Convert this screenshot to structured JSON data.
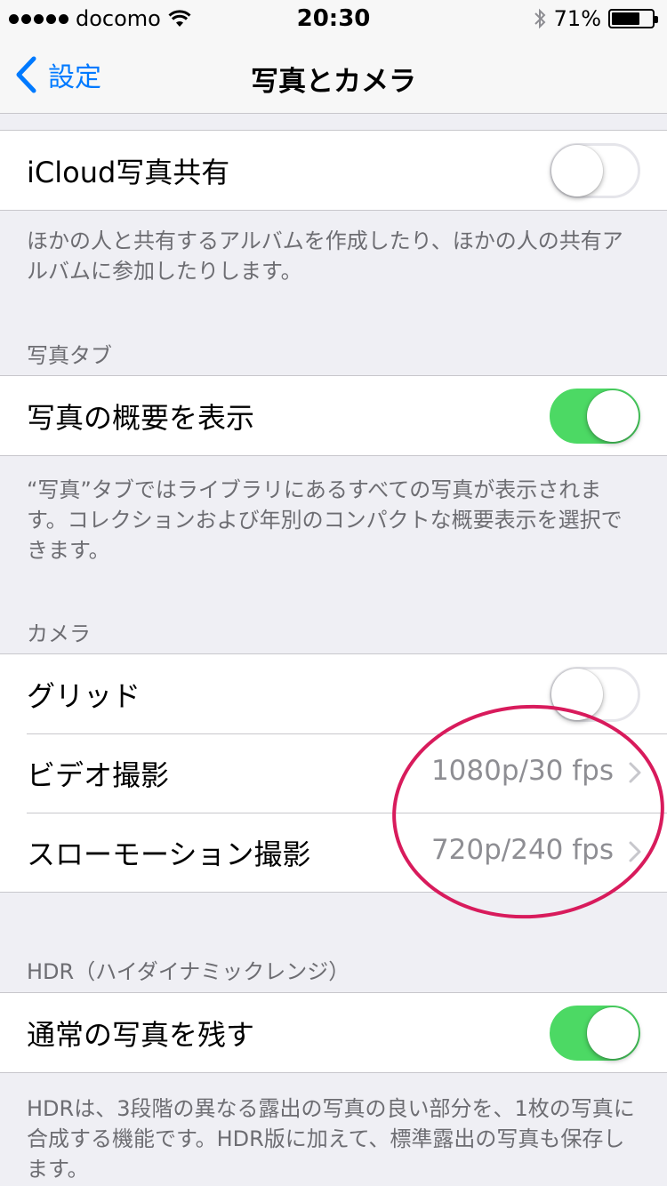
{
  "status_bar": {
    "carrier": "docomo",
    "time": "20:30",
    "battery": "71%",
    "battery_level": 0.71
  },
  "nav": {
    "back_label": "設定",
    "title": "写真とカメラ"
  },
  "icloud": {
    "label": "iCloud写真共有",
    "enabled": false,
    "footer": "ほかの人と共有するアルバムを作成したり、ほかの人の共有アルバムに参加したりします。"
  },
  "photos_tab": {
    "header": "写真タブ",
    "summary_label": "写真の概要を表示",
    "summary_enabled": true,
    "footer": "“写真”タブではライブラリにあるすべての写真が表示されます。コレクションおよび年別のコンパクトな概要表示を選択できます。"
  },
  "camera": {
    "header": "カメラ",
    "grid_label": "グリッド",
    "grid_enabled": false,
    "video_label": "ビデオ撮影",
    "video_value": "1080p/30 fps",
    "slowmo_label": "スローモーション撮影",
    "slowmo_value": "720p/240 fps"
  },
  "hdr": {
    "header": "HDR（ハイダイナミックレンジ）",
    "keep_label": "通常の写真を残す",
    "keep_enabled": true,
    "footer": "HDRは、3段階の異なる露出の写真の良い部分を、1枚の写真に合成する機能です。HDR版に加えて、標準露出の写真も保存します。"
  },
  "colors": {
    "accent": "#007aff",
    "toggle_on": "#4cd964",
    "annotation_circle": "#d81b5c"
  }
}
